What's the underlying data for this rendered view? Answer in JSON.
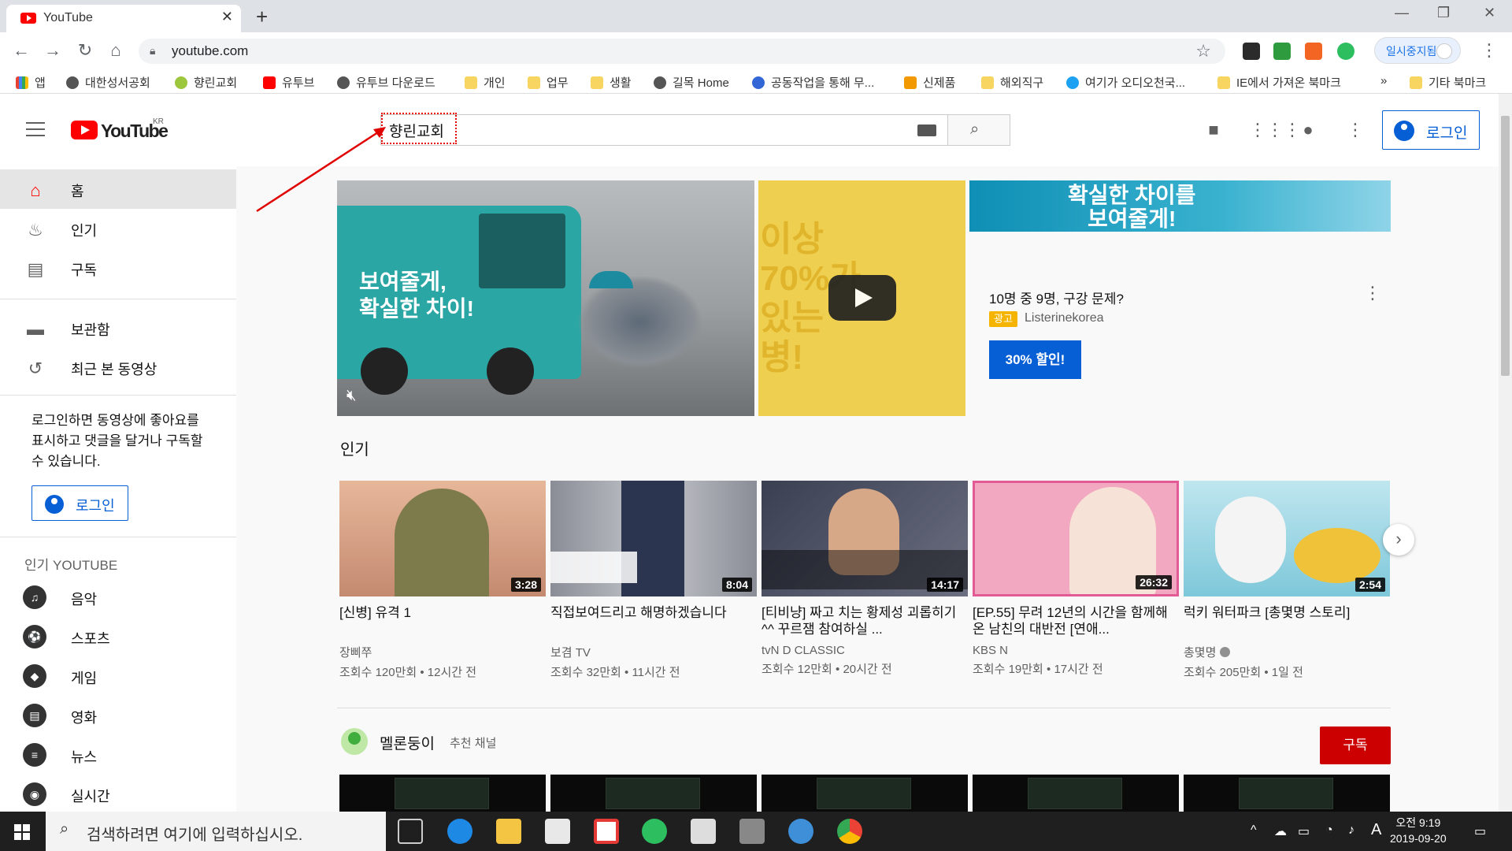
{
  "browser": {
    "tab_title": "YouTube",
    "tab_close": "✕",
    "new_tab": "+",
    "window_controls": [
      "—",
      "❐",
      "✕"
    ],
    "url": "youtube.com",
    "paused_label": "일시중지됨",
    "bookmarks": [
      {
        "label": "앱",
        "icon": "apps-grid-icon"
      },
      {
        "label": "대한성서공회",
        "icon": "globe-icon"
      },
      {
        "label": "향린교회",
        "icon": "site-icon"
      },
      {
        "label": "유투브",
        "icon": "youtube-icon"
      },
      {
        "label": "유투브 다운로드",
        "icon": "globe-icon"
      },
      {
        "label": "개인",
        "icon": "folder-icon"
      },
      {
        "label": "업무",
        "icon": "folder-icon"
      },
      {
        "label": "생활",
        "icon": "folder-icon"
      },
      {
        "label": "길목 Home",
        "icon": "globe-icon"
      },
      {
        "label": "공동작업을 통해 무...",
        "icon": "site-icon"
      },
      {
        "label": "신제품",
        "icon": "home-icon"
      },
      {
        "label": "해외직구",
        "icon": "folder-icon"
      },
      {
        "label": "여기가 오디오천국...",
        "icon": "site-icon"
      },
      {
        "label": "IE에서 가져온 북마크",
        "icon": "folder-icon"
      }
    ],
    "bookmarks_overflow": "»",
    "other_bookmarks": "기타 북마크"
  },
  "masthead": {
    "logo_text": "YouTube",
    "logo_region": "KR",
    "search_value": "향린교회",
    "login_label": "로그인"
  },
  "sidebar": {
    "main_items": [
      {
        "label": "홈",
        "icon": "home-icon"
      },
      {
        "label": "인기",
        "icon": "flame-icon"
      },
      {
        "label": "구독",
        "icon": "subscriptions-icon"
      }
    ],
    "library_items": [
      {
        "label": "보관함",
        "icon": "folder-icon"
      },
      {
        "label": "최근 본 동영상",
        "icon": "history-icon"
      }
    ],
    "signin_note": "로그인하면 동영상에 좋아요를 표시하고 댓글을 달거나 구독할 수 있습니다.",
    "signin_button": "로그인",
    "best_of_heading": "인기 YOUTUBE",
    "categories": [
      {
        "label": "음악",
        "icon": "music-icon",
        "glyph": "♫"
      },
      {
        "label": "스포츠",
        "icon": "sports-icon",
        "glyph": "⚽"
      },
      {
        "label": "게임",
        "icon": "gaming-icon",
        "glyph": "◆"
      },
      {
        "label": "영화",
        "icon": "movies-icon",
        "glyph": "▤"
      },
      {
        "label": "뉴스",
        "icon": "news-icon",
        "glyph": "≡"
      },
      {
        "label": "실시간",
        "icon": "live-icon",
        "glyph": "◉"
      }
    ]
  },
  "banner": {
    "video_text": "보여줄게,\n확실한 차이!",
    "yellow_text": "이상\n70%가\n있는\n병!",
    "ad_image_text": "확실한 차이를\n보여줄게!",
    "ad_title": "10명 중 9명, 구강 문제?",
    "ad_badge": "광고",
    "advertiser": "Listerinekorea",
    "cta_label": "30% 할인!"
  },
  "trending": {
    "section_title": "인기",
    "videos": [
      {
        "title": "[신병] 유격 1",
        "channel": "장삐쭈",
        "meta": "조회수 120만회 • 12시간 전",
        "duration": "3:28",
        "thumb_color": "#e7b79a"
      },
      {
        "title": "직접보여드리고 해명하겠습니다",
        "channel": "보겸 TV",
        "meta": "조회수 32만회 • 11시간 전",
        "duration": "8:04",
        "thumb_color": "#9c9fa8"
      },
      {
        "title": "[티비냥] 짜고 치는 황제성 괴롭히기 ^^ 꾸르잼 참여하실 ...",
        "channel": "tvN D CLASSIC",
        "meta": "조회수 12만회 • 20시간 전",
        "duration": "14:17",
        "thumb_color": "#3a3f52"
      },
      {
        "title": "[EP.55] 무려 12년의 시간을 함께해온 남친의 대반전 [연애...",
        "channel": "KBS N",
        "meta": "조회수 19만회 • 17시간 전",
        "duration": "26:32",
        "thumb_color": "#f2a8c0"
      },
      {
        "title": "럭키 워터파크 [총몇명 스토리]",
        "channel": "총몇명",
        "meta": "조회수 205만회 • 1일 전",
        "duration": "2:54",
        "thumb_color": "#8fd0e0"
      }
    ],
    "next_arrow": "›"
  },
  "channel_shelf": {
    "name": "멜론둥이",
    "recommended": "추천 채널",
    "subscribe": "구독"
  },
  "taskbar": {
    "search_placeholder": "검색하려면 여기에 입력하십시오.",
    "time": "오전 9:19",
    "date": "2019-09-20",
    "ime": "A"
  },
  "colors": {
    "youtube_red": "#ff0000",
    "link_blue": "#065fd4",
    "subscribe_red": "#cc0000",
    "highlight_box": "#e60000"
  }
}
